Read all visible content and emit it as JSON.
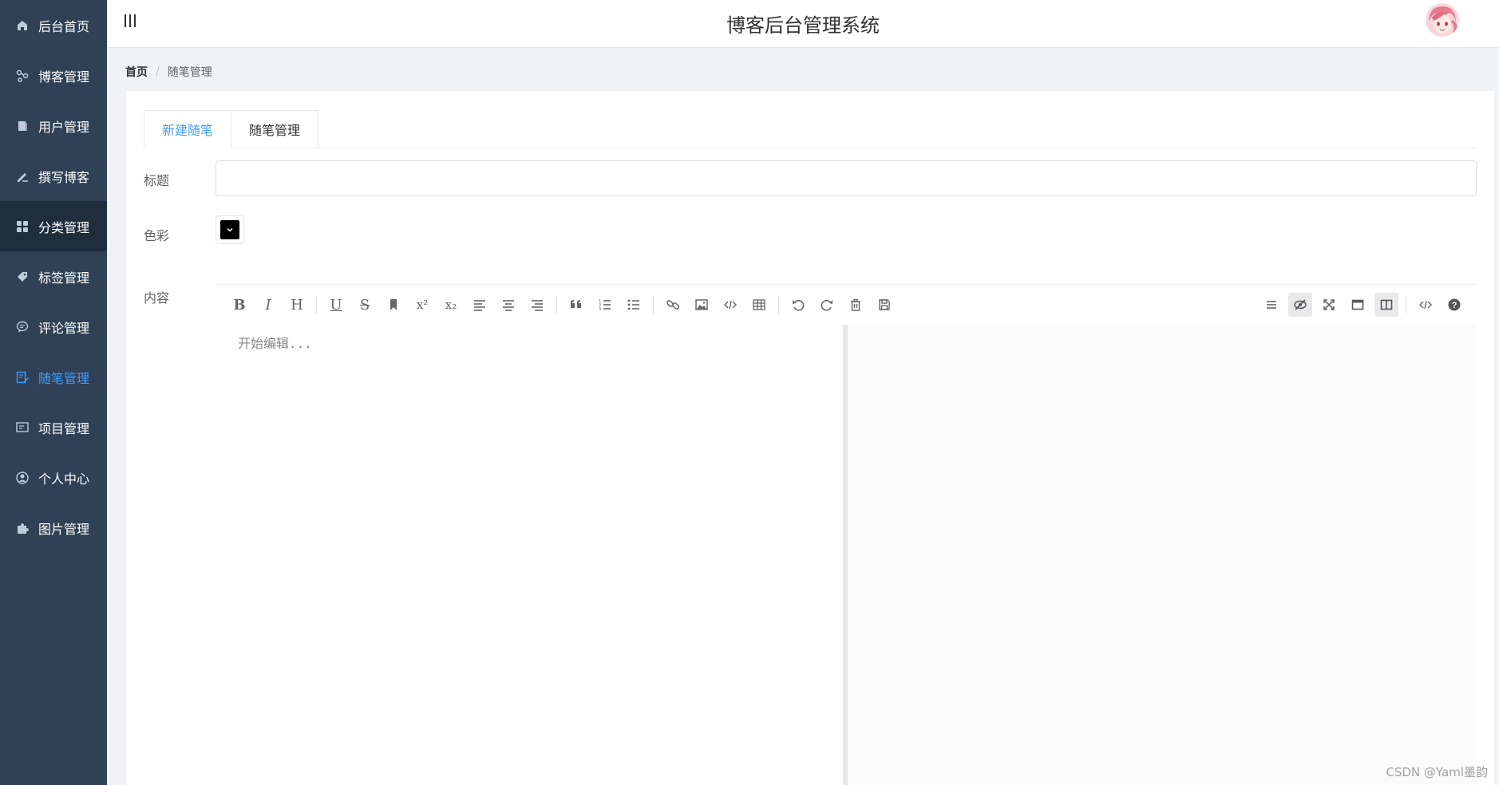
{
  "header": {
    "title": "博客后台管理系统"
  },
  "sidebar": {
    "items": [
      {
        "label": "后台首页",
        "icon": "home-icon"
      },
      {
        "label": "博客管理",
        "icon": "share-icon"
      },
      {
        "label": "用户管理",
        "icon": "user-book-icon"
      },
      {
        "label": "撰写博客",
        "icon": "pen-icon"
      },
      {
        "label": "分类管理",
        "icon": "grid-icon"
      },
      {
        "label": "标签管理",
        "icon": "tag-icon"
      },
      {
        "label": "评论管理",
        "icon": "comment-icon"
      },
      {
        "label": "随笔管理",
        "icon": "edit-doc-icon"
      },
      {
        "label": "项目管理",
        "icon": "project-icon"
      },
      {
        "label": "个人中心",
        "icon": "person-icon"
      },
      {
        "label": "图片管理",
        "icon": "puzzle-icon"
      }
    ],
    "active_index": 7,
    "hover_index": 4
  },
  "breadcrumb": {
    "home": "首页",
    "separator": "/",
    "current": "随笔管理"
  },
  "tabs": [
    {
      "label": "新建随笔",
      "active": true
    },
    {
      "label": "随笔管理",
      "active": false
    }
  ],
  "form": {
    "title_label": "标题",
    "title_value": "",
    "color_label": "色彩",
    "color_value": "#000000",
    "content_label": "内容"
  },
  "editor": {
    "placeholder": "开始编辑...",
    "toolbar_left": [
      "bold-icon",
      "italic-icon",
      "header-icon",
      "underline-icon",
      "strikethrough-icon",
      "mark-icon",
      "superscript-icon",
      "subscript-icon",
      "align-left-icon",
      "align-center-icon",
      "align-right-icon",
      "quote-icon",
      "ordered-list-icon",
      "unordered-list-icon",
      "link-icon",
      "image-icon",
      "code-icon",
      "table-icon",
      "undo-icon",
      "redo-icon",
      "trash-icon",
      "save-icon"
    ],
    "toolbar_right": [
      "navigation-icon",
      "preview-toggle-icon",
      "fullscreen-icon",
      "window-icon",
      "subfield-icon",
      "html-code-icon",
      "help-icon"
    ]
  },
  "watermark": "CSDN @Yaml墨韵",
  "colors": {
    "sidebar_bg": "#304156",
    "accent": "#409eff"
  }
}
